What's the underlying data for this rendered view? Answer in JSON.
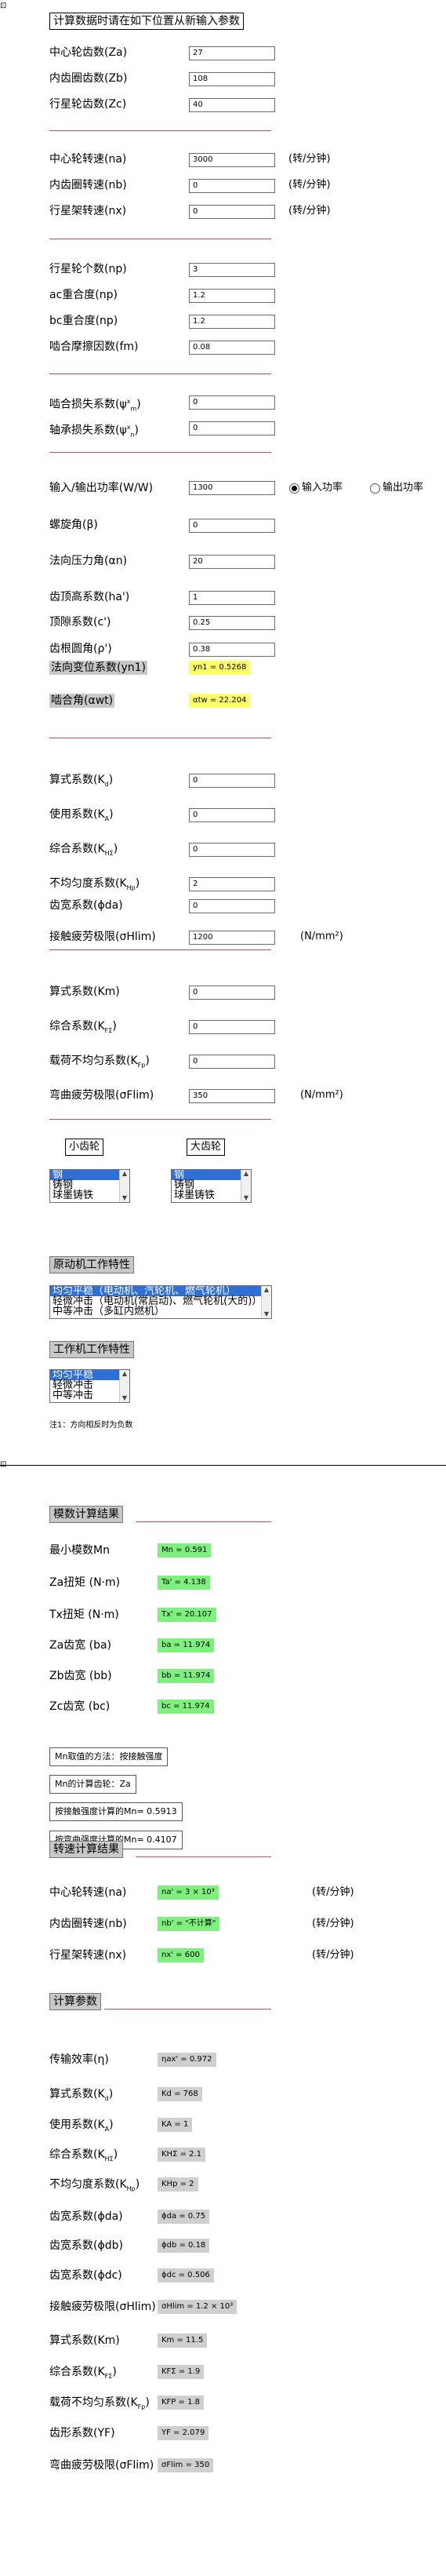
{
  "sec1": {
    "title": "计算数据时请在如下位置从新输入参数",
    "rows": [
      {
        "label": "中心轮齿数(Za)",
        "value": "27"
      },
      {
        "label": "内齿圈齿数(Zb)",
        "value": "108"
      },
      {
        "label": "行星轮齿数(Zc)",
        "value": "40"
      }
    ]
  },
  "sec2": {
    "rows": [
      {
        "label": "中心轮转速(na)",
        "value": "3000",
        "unit": "(转/分钟)"
      },
      {
        "label": "内齿圈转速(nb)",
        "value": "0",
        "unit": "(转/分钟)"
      },
      {
        "label": "行星架转速(nx)",
        "value": "0",
        "unit": "(转/分钟)"
      }
    ]
  },
  "sec3": {
    "rows": [
      {
        "label": "行星轮个数(np)",
        "value": "3"
      },
      {
        "label": "ac重合度(np)",
        "value": "1.2"
      },
      {
        "label": "bc重合度(np)",
        "value": "1.2"
      },
      {
        "label": "啮合摩擦因数(fm)",
        "value": "0.08"
      }
    ]
  },
  "sec4": {
    "rows": [
      {
        "label": "啮合损失系数(ψ",
        "sub": "m",
        "sup": "x",
        "tail": ")",
        "value": "0"
      },
      {
        "label": "轴承损失系数(ψ",
        "sub": "n",
        "sup": "x",
        "tail": ")",
        "value": "0"
      }
    ]
  },
  "sec5": {
    "power_label": "输入/输出功率(W/W)",
    "power_value": "1300",
    "radio_input": "输入功率",
    "radio_output": "输出功率",
    "rows": [
      {
        "label": "螺旋角(β)",
        "value": "0"
      },
      {
        "label": "法向压力角(αn)",
        "value": "20"
      },
      {
        "label": "齿顶高系数(ha')",
        "value": "1"
      },
      {
        "label": "顶隙系数(c')",
        "value": "0.25"
      },
      {
        "label": "齿根圆角(ρ')",
        "value": "0.38"
      }
    ],
    "shift_label": "法向变位系数(yn1)",
    "shift_value": "yn1 = 0.5268",
    "mesh_label": "啮合角(αwt)",
    "mesh_value": "αtw = 22.204"
  },
  "sec6": {
    "rows": [
      {
        "label": "算式系数(K",
        "sub": "d",
        "tail": ")",
        "value": "0"
      },
      {
        "label": "使用系数(K",
        "sub": "A",
        "tail": ")",
        "value": "0"
      },
      {
        "label": "综合系数(K",
        "sub": "HΣ",
        "tail": ")",
        "value": "0"
      },
      {
        "label": "不均匀度系数(K",
        "sub": "Hp",
        "tail": ")",
        "value": "2"
      },
      {
        "label": "齿宽系数(ϕda)",
        "value": "0"
      },
      {
        "label": "接触疲劳极限(σHlim)",
        "value": "1200",
        "unit": "(N/mm²)"
      }
    ]
  },
  "sec7": {
    "rows": [
      {
        "label": "算式系数(Km)",
        "value": "0"
      },
      {
        "label": "综合系数(K",
        "sub": "FΣ",
        "tail": ")",
        "value": "0"
      },
      {
        "label": "载荷不均匀系数(K",
        "sub": "Fp",
        "tail": ")",
        "value": "0"
      },
      {
        "label": "弯曲疲劳极限(σFlim)",
        "value": "350",
        "unit": "(N/mm²)"
      }
    ]
  },
  "gears": {
    "small_title": "小齿轮",
    "large_title": "大齿轮",
    "options": [
      "钢",
      "铸钢",
      "球墨铸铁"
    ]
  },
  "prime_mover": {
    "title": "原动机工作特性",
    "options": [
      "均匀平稳（电动机、汽轮机、燃气轮机）",
      "轻微冲击（电动机(常启动)、燃气轮机(大的)）",
      "中等冲击（多缸内燃机）"
    ]
  },
  "work_machine": {
    "title": "工作机工作特性",
    "options": [
      "均匀平稳",
      "轻微冲击",
      "中等冲击"
    ]
  },
  "note": "注1：方向相反时为负数",
  "modulus": {
    "title": "模数计算结果",
    "rows": [
      {
        "label": "最小模数Mn",
        "value": "Mn = 0.591"
      },
      {
        "label": "Za扭矩 (N·m)",
        "value": "Ta' = 4.138"
      },
      {
        "label": "Tx扭矩 (N·m)",
        "value": "Tx' = 20.107"
      },
      {
        "label": "Za齿宽 (ba)",
        "value": "ba = 11.974"
      },
      {
        "label": "Zb齿宽 (bb)",
        "value": "bb = 11.974"
      },
      {
        "label": "Zc齿宽 (bc)",
        "value": "bc = 11.974"
      }
    ],
    "boxes": [
      "Mn取值的方法：按接触强度",
      "Mn的计算齿轮：Za",
      "按接触强度计算的Mn= 0.5913",
      "按弯曲强度计算的Mn= 0.4107"
    ]
  },
  "speed": {
    "title": "转速计算结果",
    "rows": [
      {
        "label": "中心轮转速(na)",
        "value": "na' = 3 × 10³",
        "unit": "(转/分钟)"
      },
      {
        "label": "内齿圈转速(nb)",
        "value": "nb' = \"不计算\"",
        "unit": "(转/分钟)"
      },
      {
        "label": "行星架转速(nx)",
        "value": "nx' = 600",
        "unit": "(转/分钟)"
      }
    ]
  },
  "params": {
    "title": "计算参数",
    "rows": [
      {
        "label": "传输效率(η)",
        "value": "ηax' = 0.972"
      },
      {
        "label": "算式系数(K",
        "sub": "d",
        "tail": ")",
        "value": "Kd = 768"
      },
      {
        "label": "使用系数(K",
        "sub": "A",
        "tail": ")",
        "value": "KA = 1"
      },
      {
        "label": "综合系数(K",
        "sub": "HΣ",
        "tail": ")",
        "value": "KHΣ = 2.1"
      },
      {
        "label": "不均匀度系数(K",
        "sub": "Hp",
        "tail": ")",
        "value": "KHp = 2"
      },
      {
        "label": "齿宽系数(ϕda)",
        "value": "ϕda = 0.75"
      },
      {
        "label": "齿宽系数(ϕdb)",
        "value": "ϕdb = 0.18"
      },
      {
        "label": "齿宽系数(ϕdc)",
        "value": "ϕdc = 0.506"
      },
      {
        "label": "接触疲劳极限(σHlim)",
        "value": "σHlim = 1.2 × 10³"
      },
      {
        "label": "算式系数(Km)",
        "value": "Km = 11.5"
      },
      {
        "label": "综合系数(K",
        "sub": "FΣ",
        "tail": ")",
        "value": "KFΣ = 1.9"
      },
      {
        "label": "载荷不均匀系数(K",
        "sub": "Fp",
        "tail": ")",
        "value": "KFP = 1.8"
      },
      {
        "label": "齿形系数(YF)",
        "value": "YF = 2.079"
      },
      {
        "label": "弯曲疲劳极限(σFlim)",
        "value": "σFlim = 350"
      }
    ]
  }
}
